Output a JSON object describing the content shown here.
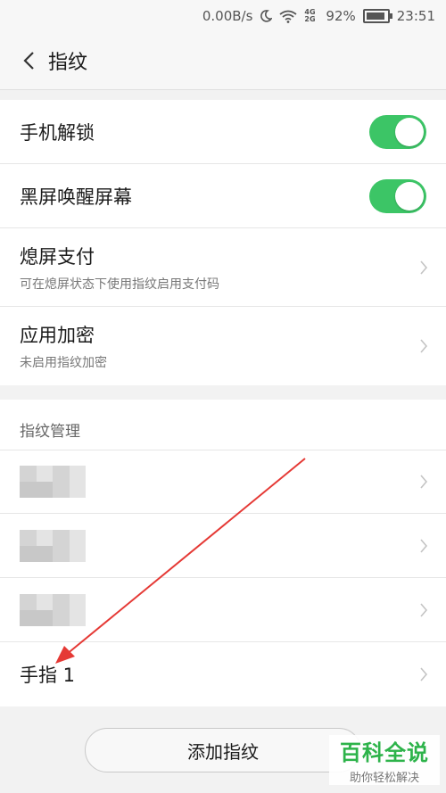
{
  "statusbar": {
    "speed": "0.00B/s",
    "network": "4G 2G",
    "battery_percent": "92%",
    "battery_level": 0.92,
    "time": "23:51"
  },
  "header": {
    "title": "指纹"
  },
  "settings": [
    {
      "label": "手机解锁",
      "toggle": true
    },
    {
      "label": "黑屏唤醒屏幕",
      "toggle": true
    },
    {
      "label": "熄屏支付",
      "sub": "可在熄屏状态下使用指纹启用支付码"
    },
    {
      "label": "应用加密",
      "sub": "未启用指纹加密"
    }
  ],
  "fingerprint_section": {
    "title": "指纹管理",
    "last_item": "手指 1"
  },
  "add_button": "添加指纹",
  "watermark": {
    "main": "百科全说",
    "sub": "助你轻松解决"
  },
  "colors": {
    "toggle_on": "#3cc566",
    "watermark": "#2db34a",
    "annotation_arrow": "#e53935"
  }
}
